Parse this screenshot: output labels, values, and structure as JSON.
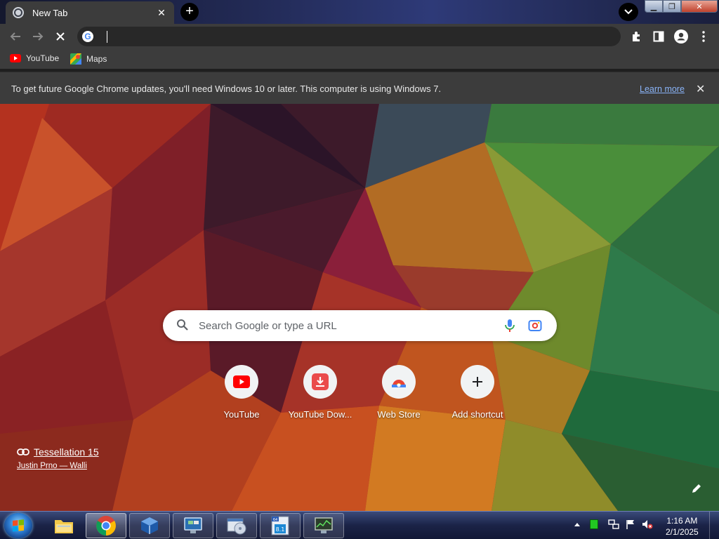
{
  "tab": {
    "title": "New Tab",
    "close": "✕"
  },
  "toolbar": {
    "omnibox_value": ""
  },
  "bookmarks": [
    {
      "label": "YouTube",
      "icon": "youtube-icon"
    },
    {
      "label": "Maps",
      "icon": "maps-icon"
    }
  ],
  "infobar": {
    "message": "To get future Google Chrome updates, you'll need Windows 10 or later. This computer is using Windows 7.",
    "link": "Learn more",
    "close": "✕"
  },
  "search": {
    "placeholder": "Search Google or type a URL"
  },
  "shortcuts": [
    {
      "label": "YouTube",
      "icon": "youtube-icon"
    },
    {
      "label": "YouTube Dow...",
      "icon": "download-icon"
    },
    {
      "label": "Web Store",
      "icon": "chrome-web-store-icon"
    },
    {
      "label": "Add shortcut",
      "icon": "plus-icon"
    }
  ],
  "attribution": {
    "title": "Tessellation 15",
    "author": "Justin Prno — Walli"
  },
  "taskbar": {
    "time": "1:16 AM",
    "date": "2/1/2025"
  },
  "colors": {
    "accent": "#8ab4f8",
    "chrome_dark": "#3c3c3c",
    "omnibox": "#282828"
  }
}
